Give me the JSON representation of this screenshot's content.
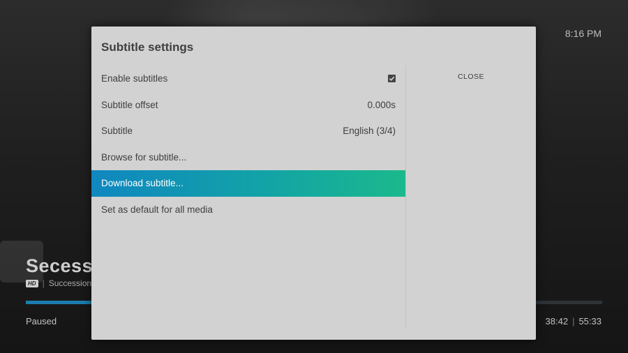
{
  "player": {
    "clock": "8:16 PM",
    "show_title": "Secessio",
    "badge": "HD",
    "subtitle_text": "Succession",
    "status": "Paused",
    "elapsed": "38:42",
    "total": "55:33",
    "progress_percent": 70
  },
  "dialog": {
    "title": "Subtitle settings",
    "close_label": "CLOSE",
    "items": [
      {
        "label": "Enable subtitles",
        "value": "",
        "checked": true
      },
      {
        "label": "Subtitle offset",
        "value": "0.000s"
      },
      {
        "label": "Subtitle",
        "value": "English (3/4)"
      },
      {
        "label": "Browse for subtitle...",
        "value": ""
      },
      {
        "label": "Download subtitle...",
        "value": "",
        "selected": true
      },
      {
        "label": "Set as default for all media",
        "value": ""
      }
    ]
  },
  "colors": {
    "selected_gradient_start": "#1087c0",
    "selected_gradient_end": "#1bb98c",
    "progress": "#1c7cae"
  }
}
